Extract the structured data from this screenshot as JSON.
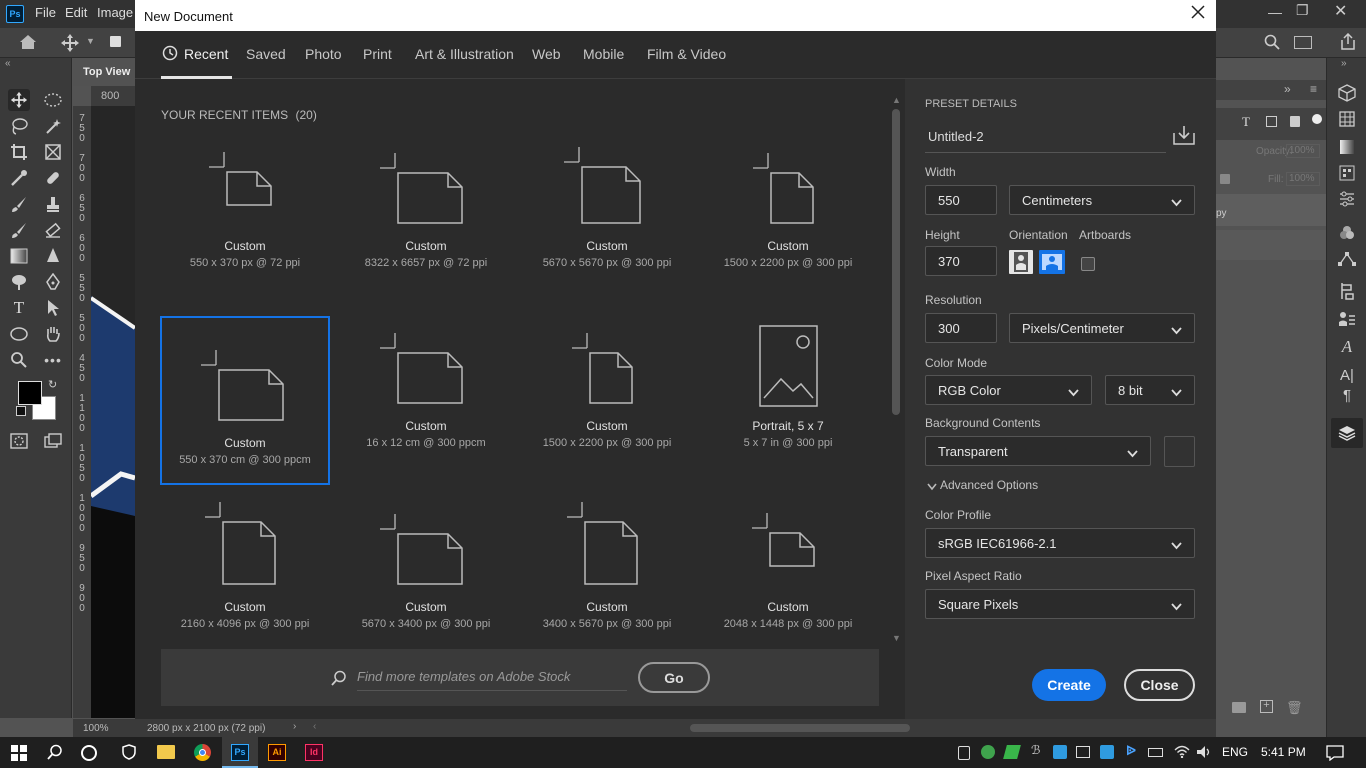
{
  "app": {
    "menu": [
      "File",
      "Edit",
      "Image"
    ],
    "logo": "Ps",
    "doc_tab": "Top View",
    "ruler_top": "800",
    "ruler_left": "7\n5\n0\n\n7\n0\n0\n\n6\n5\n0\n\n6\n0\n0\n\n5\n5\n0\n\n5\n0\n0\n\n4\n5\n0\n\n1\n1\n0\n0\n\n1\n0\n5\n0\n\n1\n0\n0\n0\n\n9\n5\n0\n\n9\n0\n0",
    "status_zoom": "100%",
    "status_size": "2800 px x 2100 px (72 ppi)",
    "opacity_label": "Opacity:",
    "opacity_value": "100%",
    "fill_label": "Fill:",
    "fill_value": "100%",
    "layer_text": "py"
  },
  "dialog": {
    "title": "New Document",
    "tabs": [
      "Recent",
      "Saved",
      "Photo",
      "Print",
      "Art & Illustration",
      "Web",
      "Mobile",
      "Film & Video"
    ],
    "active_tab": "Recent",
    "section_title": "YOUR RECENT ITEMS",
    "section_count": "(20)",
    "items": [
      {
        "name": "Custom",
        "size": "550 x 370 px @ 72 ppi",
        "shape": "landscape"
      },
      {
        "name": "Custom",
        "size": "8322 x 6657 px @ 72 ppi",
        "shape": "landscape-big"
      },
      {
        "name": "Custom",
        "size": "5670 x 5670 px @ 300 ppi",
        "shape": "square"
      },
      {
        "name": "Custom",
        "size": "1500 x 2200 px @ 300 ppi",
        "shape": "portrait"
      },
      {
        "name": "Custom",
        "size": "550 x 370 cm @ 300 ppcm",
        "shape": "landscape-big",
        "selected": true
      },
      {
        "name": "Custom",
        "size": "16 x 12 cm @ 300 ppcm",
        "shape": "landscape-big"
      },
      {
        "name": "Custom",
        "size": "1500 x 2200 px @ 300 ppi",
        "shape": "portrait"
      },
      {
        "name": "Portrait, 5 x 7",
        "size": "5 x 7 in @ 300 ppi",
        "shape": "photo"
      },
      {
        "name": "Custom",
        "size": "2160 x 4096 px @ 300 ppi",
        "shape": "tall"
      },
      {
        "name": "Custom",
        "size": "5670 x 3400 px @ 300 ppi",
        "shape": "landscape-big"
      },
      {
        "name": "Custom",
        "size": "3400 x 5670 px @ 300 ppi",
        "shape": "tall"
      },
      {
        "name": "Custom",
        "size": "2048 x 1448 px @ 300 ppi",
        "shape": "landscape"
      }
    ],
    "search_placeholder": "Find more templates on Adobe Stock",
    "go_label": "Go",
    "preset": {
      "heading": "PRESET DETAILS",
      "name": "Untitled-2",
      "width_label": "Width",
      "width": "550",
      "width_unit": "Centimeters",
      "height_label": "Height",
      "height": "370",
      "orientation_label": "Orientation",
      "artboards_label": "Artboards",
      "resolution_label": "Resolution",
      "resolution": "300",
      "resolution_unit": "Pixels/Centimeter",
      "color_mode_label": "Color Mode",
      "color_mode": "RGB Color",
      "bit_depth": "8 bit",
      "background_label": "Background Contents",
      "background": "Transparent",
      "advanced_label": "Advanced Options",
      "color_profile_label": "Color Profile",
      "color_profile": "sRGB IEC61966-2.1",
      "pixel_aspect_label": "Pixel Aspect Ratio",
      "pixel_aspect": "Square Pixels"
    },
    "create_label": "Create",
    "close_label": "Close"
  },
  "taskbar": {
    "lang": "ENG",
    "time": "5:41 PM"
  },
  "colors": {
    "accent": "#1473e6",
    "ps_blue": "#31a8ff",
    "ai_orange": "#ff9a00",
    "id_pink": "#ff3366"
  }
}
